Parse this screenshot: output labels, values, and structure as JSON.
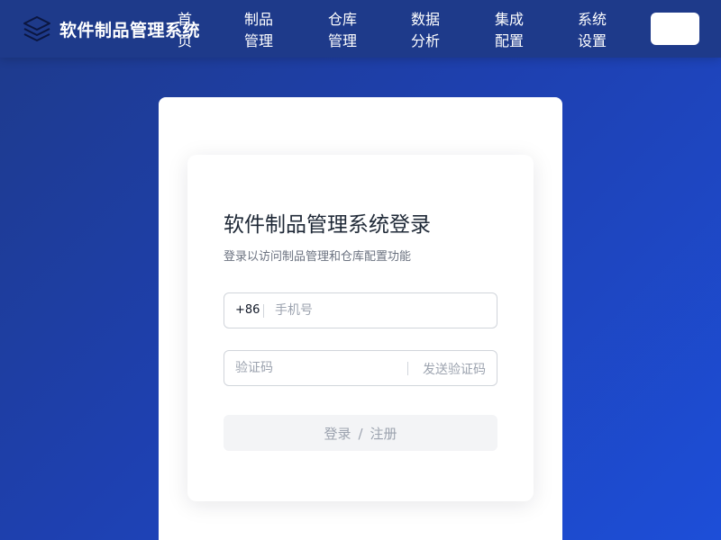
{
  "brand": {
    "title": "软件制品管理系统",
    "icon": "layers-icon"
  },
  "nav": {
    "items": [
      {
        "id": "home",
        "label": "首页"
      },
      {
        "id": "artifacts",
        "label": "制品管理"
      },
      {
        "id": "warehouse",
        "label": "仓库管理"
      },
      {
        "id": "analytics",
        "label": "数据分析"
      },
      {
        "id": "integration",
        "label": "集成配置"
      },
      {
        "id": "settings",
        "label": "系统设置"
      }
    ],
    "action_button_label": ""
  },
  "login": {
    "title": "软件制品管理系统登录",
    "subtitle": "登录以访问制品管理和仓库配置功能",
    "phone_prefix": "+86",
    "phone_placeholder": "手机号",
    "phone_value": "",
    "code_placeholder": "验证码",
    "code_value": "",
    "send_code_label": "发送验证码",
    "submit_login": "登录",
    "submit_separator": "/",
    "submit_register": "注册"
  },
  "colors": {
    "navbar": "#1e3a8a",
    "background_start": "#1e3a8a",
    "background_end": "#1d4ed8",
    "card": "#ffffff",
    "disabled_button": "#f3f4f6",
    "muted_text": "#9ca3af"
  }
}
